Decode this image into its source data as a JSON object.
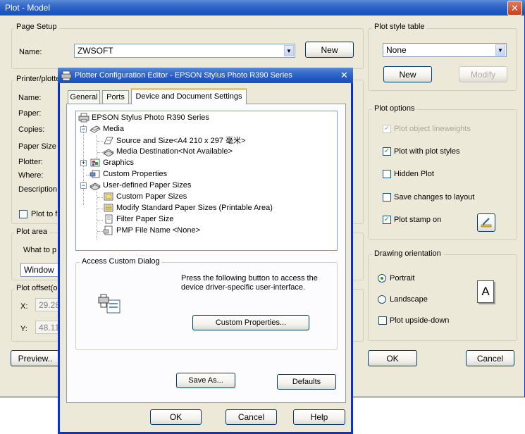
{
  "main_window": {
    "title": "Plot - Model",
    "page_setup": {
      "legend": "Page Setup",
      "name_label": "Name:",
      "name_value": "ZWSOFT",
      "new_button": "New"
    },
    "printer": {
      "legend": "Printer/plotte",
      "name_label": "Name:",
      "paper_label": "Paper:",
      "copies_label": "Copies:",
      "paper_size_label": "Paper Size",
      "plotter_label": "Plotter:",
      "where_label": "Where:",
      "description_label": "Description:",
      "plot_to_file": "Plot to fi"
    },
    "plot_area": {
      "legend": "Plot area",
      "what_label": "What to p",
      "what_value": "Window"
    },
    "plot_offset": {
      "legend": "Plot offset(or",
      "x_label": "X:",
      "x_value": "29.28",
      "y_label": "Y:",
      "y_value": "48.11"
    },
    "preview_button": "Preview..",
    "plot_style_table": {
      "legend": "Plot style table",
      "value": "None",
      "new_button": "New",
      "modify_button": "Modify"
    },
    "plot_options": {
      "legend": "Plot options",
      "items": [
        {
          "label": "Plot object lineweights",
          "checked": true,
          "disabled": true
        },
        {
          "label": "Plot with plot styles",
          "checked": true,
          "disabled": false
        },
        {
          "label": "Hidden Plot",
          "checked": false,
          "disabled": false
        },
        {
          "label": "Save changes to layout",
          "checked": false,
          "disabled": false
        },
        {
          "label": "Plot stamp on",
          "checked": true,
          "disabled": false
        }
      ]
    },
    "drawing_orientation": {
      "legend": "Drawing orientation",
      "portrait": "Portrait",
      "landscape": "Landscape",
      "upside_down": "Plot upside-down",
      "orientation_glyph": "A"
    },
    "ok_button": "OK",
    "cancel_button": "Cancel"
  },
  "dialog": {
    "title": "Plotter Configuration Editor - EPSON Stylus Photo R390 Series",
    "tabs": [
      {
        "label": "General",
        "active": false
      },
      {
        "label": "Ports",
        "active": false
      },
      {
        "label": "Device and Document Settings",
        "active": true
      }
    ],
    "tree": [
      {
        "label": "EPSON Stylus Photo R390 Series",
        "level": 0,
        "icon": "printer-icon",
        "expander": ""
      },
      {
        "label": "Media",
        "level": 1,
        "icon": "media-icon",
        "expander": "−"
      },
      {
        "label": "Source and Size<A4 210 x 297 毫米>",
        "level": 2,
        "icon": "paper-source-icon",
        "expander": ""
      },
      {
        "label": "Media Destination<Not Available>",
        "level": 2,
        "icon": "media-destination-icon",
        "expander": ""
      },
      {
        "label": "Graphics",
        "level": 1,
        "icon": "graphics-icon",
        "expander": "+"
      },
      {
        "label": "Custom Properties",
        "level": 1,
        "icon": "custom-properties-icon",
        "expander": ""
      },
      {
        "label": "User-defined Paper Sizes",
        "level": 1,
        "icon": "user-paper-icon",
        "expander": "−"
      },
      {
        "label": "Custom Paper Sizes",
        "level": 2,
        "icon": "custom-paper-icon",
        "expander": ""
      },
      {
        "label": "Modify Standard Paper Sizes (Printable Area)",
        "level": 2,
        "icon": "modify-paper-icon",
        "expander": ""
      },
      {
        "label": "Filter Paper Size",
        "level": 2,
        "icon": "filter-paper-icon",
        "expander": ""
      },
      {
        "label": "PMP File Name <None>",
        "level": 2,
        "icon": "pmp-file-icon",
        "expander": ""
      }
    ],
    "access_group": {
      "legend": "Access Custom Dialog",
      "description": "Press the following button to access the device driver-specific user-interface.",
      "custom_properties_button": "Custom Properties..."
    },
    "save_as_button": "Save As...",
    "defaults_button": "Defaults",
    "ok_button": "OK",
    "cancel_button": "Cancel",
    "help_button": "Help"
  },
  "colors": {
    "titlebar_blue": "#2257c8",
    "dialog_face": "#ece9d8",
    "check_green": "#21a121",
    "xp_border": "#003c74"
  }
}
